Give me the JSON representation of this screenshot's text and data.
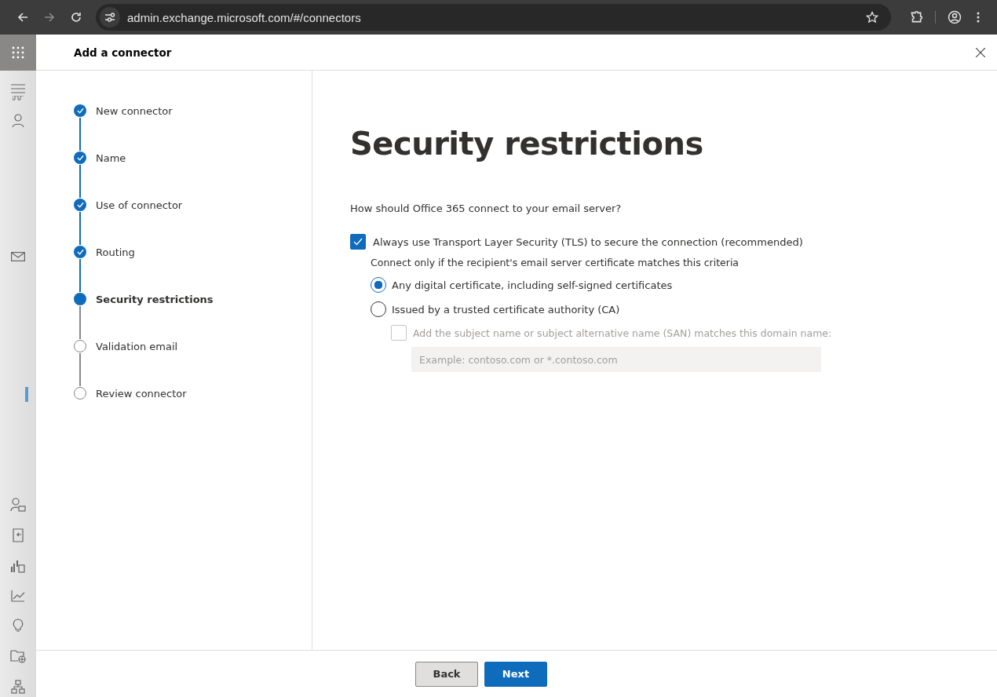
{
  "browser": {
    "url": "admin.exchange.microsoft.com/#/connectors"
  },
  "panel": {
    "title": "Add a connector"
  },
  "steps": [
    {
      "label": "New connector",
      "completed": true,
      "selected": false
    },
    {
      "label": "Name",
      "completed": true,
      "selected": false
    },
    {
      "label": "Use of connector",
      "completed": true,
      "selected": false
    },
    {
      "label": "Routing",
      "completed": true,
      "selected": false
    },
    {
      "label": "Security restrictions",
      "completed": false,
      "selected": true
    },
    {
      "label": "Validation email",
      "completed": false,
      "selected": false
    },
    {
      "label": "Review connector",
      "completed": false,
      "selected": false
    }
  ],
  "page": {
    "heading": "Security restrictions",
    "question": "How should Office 365 connect to your email server?"
  },
  "tls": {
    "label": "Always use Transport Layer Security (TLS) to secure the connection (recommended)",
    "checked": true
  },
  "criteria": "Connect only if the recipient's email server certificate matches this criteria",
  "options": [
    {
      "label": "Any digital certificate, including self-signed certificates",
      "selected": true
    },
    {
      "label": "Issued by a trusted certificate authority (CA)",
      "selected": false
    }
  ],
  "san": {
    "label": "Add the subject name or subject alternative name (SAN) matches this domain name:",
    "checked": false,
    "disabled": true
  },
  "domain_field": {
    "placeholder": "Example: contoso.com or *.contoso.com",
    "disabled": true
  },
  "buttons": [
    {
      "label": "Back",
      "kind": "secondary"
    },
    {
      "label": "Next",
      "kind": "primary"
    }
  ]
}
